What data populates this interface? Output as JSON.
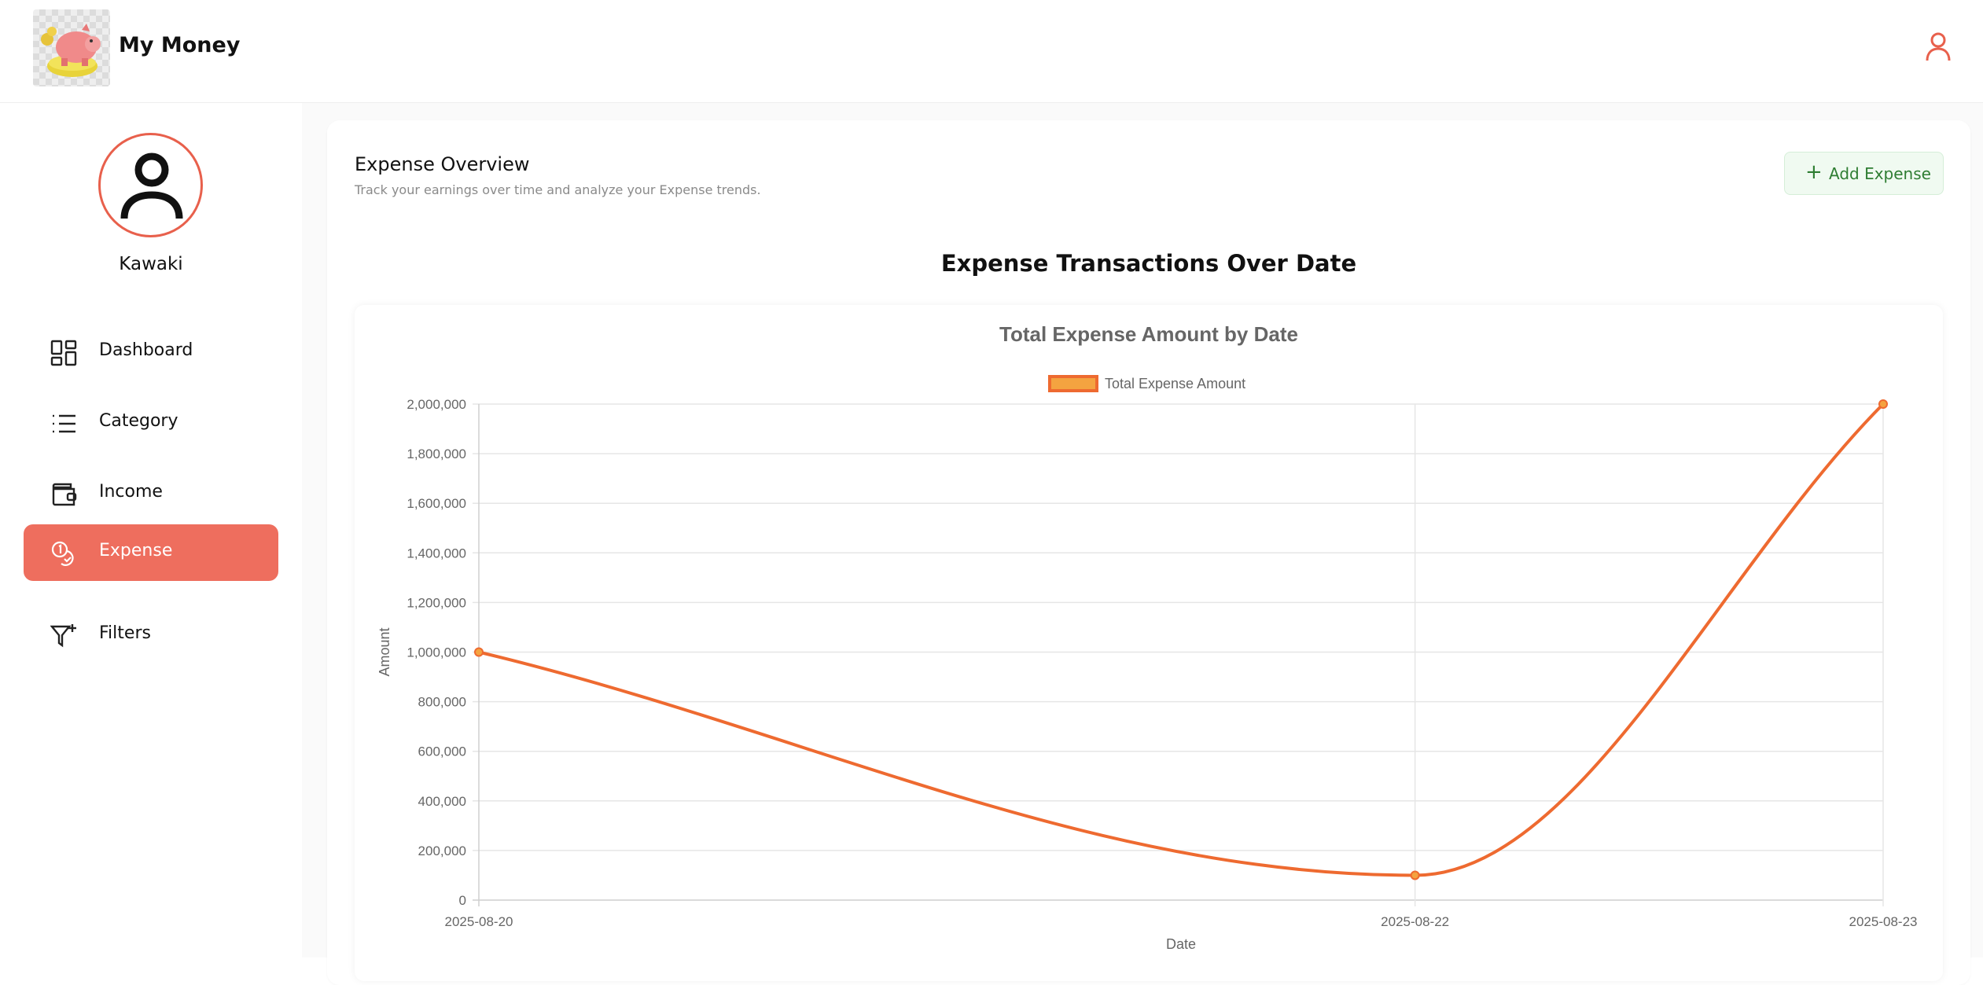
{
  "header": {
    "app_title": "My Money",
    "logo_icon": "piggy-bank-logo",
    "user_icon": "user-icon"
  },
  "sidebar": {
    "username": "Kawaki",
    "items": [
      {
        "label": "Dashboard",
        "icon": "dashboard-icon",
        "active": false
      },
      {
        "label": "Category",
        "icon": "list-icon",
        "active": false
      },
      {
        "label": "Income",
        "icon": "wallet-icon",
        "active": false
      },
      {
        "label": "Expense",
        "icon": "coins-icon",
        "active": true
      },
      {
        "label": "Filters",
        "icon": "filter-icon",
        "active": false
      }
    ]
  },
  "main": {
    "title": "Expense Overview",
    "subtitle": "Track your earnings over time and analyze your Expense trends.",
    "add_button_label": "Add Expense",
    "section_title": "Expense Transactions Over Date"
  },
  "colors": {
    "accent": "#ee6e5e",
    "line": "#ee6a30",
    "point": "#f4a340",
    "add_button_text": "#2e7d32"
  },
  "chart_data": {
    "type": "line",
    "title": "Total Expense Amount by Date",
    "xlabel": "Date",
    "ylabel": "Amount",
    "categories": [
      "2025-08-20",
      "2025-08-22",
      "2025-08-23"
    ],
    "series": [
      {
        "name": "Total Expense Amount",
        "values": [
          1000000,
          100000,
          2000000
        ]
      }
    ],
    "ylim": [
      0,
      2000000
    ],
    "yticks": [
      "0",
      "200,000",
      "400,000",
      "600,000",
      "800,000",
      "1,000,000",
      "1,200,000",
      "1,400,000",
      "1,600,000",
      "1,800,000",
      "2,000,000"
    ],
    "grid": true,
    "legend": "top-center"
  }
}
